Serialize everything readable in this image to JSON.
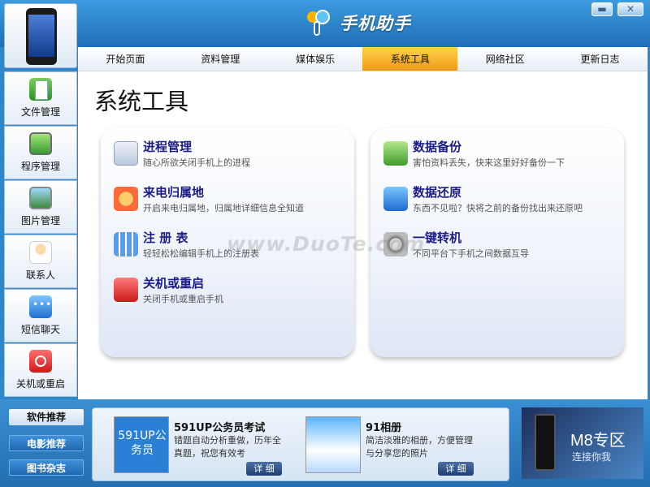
{
  "window": {
    "brand": "手机助手",
    "min_glyph": "▬",
    "close_glyph": "✕"
  },
  "tabs": [
    "开始页面",
    "资料管理",
    "媒体娱乐",
    "系统工具",
    "网络社区",
    "更新日志"
  ],
  "active_tab": "系统工具",
  "sidebar": [
    {
      "label": "文件管理",
      "icon": "file-icon"
    },
    {
      "label": "程序管理",
      "icon": "app-icon"
    },
    {
      "label": "图片管理",
      "icon": "picture-icon"
    },
    {
      "label": "联系人",
      "icon": "contact-icon"
    },
    {
      "label": "短信聊天",
      "icon": "sms-icon"
    },
    {
      "label": "关机或重启",
      "icon": "power-icon"
    }
  ],
  "main": {
    "title": "系统工具",
    "left_tools": [
      {
        "name": "进程管理",
        "desc": "随心所欲关闭手机上的进程"
      },
      {
        "name": "来电归属地",
        "desc": "开启来电归属地，归属地详细信息全知道"
      },
      {
        "name": "注 册 表",
        "desc": "轻轻松松编辑手机上的注册表"
      },
      {
        "name": "关机或重启",
        "desc": "关闭手机或重启手机"
      }
    ],
    "right_tools": [
      {
        "name": "数据备份",
        "desc": "害怕资料丢失，快来这里好好备份一下"
      },
      {
        "name": "数据还原",
        "desc": "东西不见啦？快将之前的备份找出来还原吧"
      },
      {
        "name": "一键转机",
        "desc": "不同平台下手机之间数据互导"
      }
    ],
    "watermark": "www.DuoTe.com"
  },
  "bottom": {
    "nav": [
      "软件推荐",
      "电影推荐",
      "图书杂志"
    ],
    "recs": [
      {
        "title": "591UP公务员考试",
        "desc": "错题自动分析重做，历年全真题，祝您有效考",
        "more": "详 细",
        "thumb_text": "591UP公务员"
      },
      {
        "title": "91相册",
        "desc": "简洁淡雅的相册，方便管理与分享您的照片",
        "more": "详 细",
        "thumb_text": ""
      }
    ],
    "ad": {
      "title": "M8专区",
      "sub": "连接你我"
    }
  }
}
